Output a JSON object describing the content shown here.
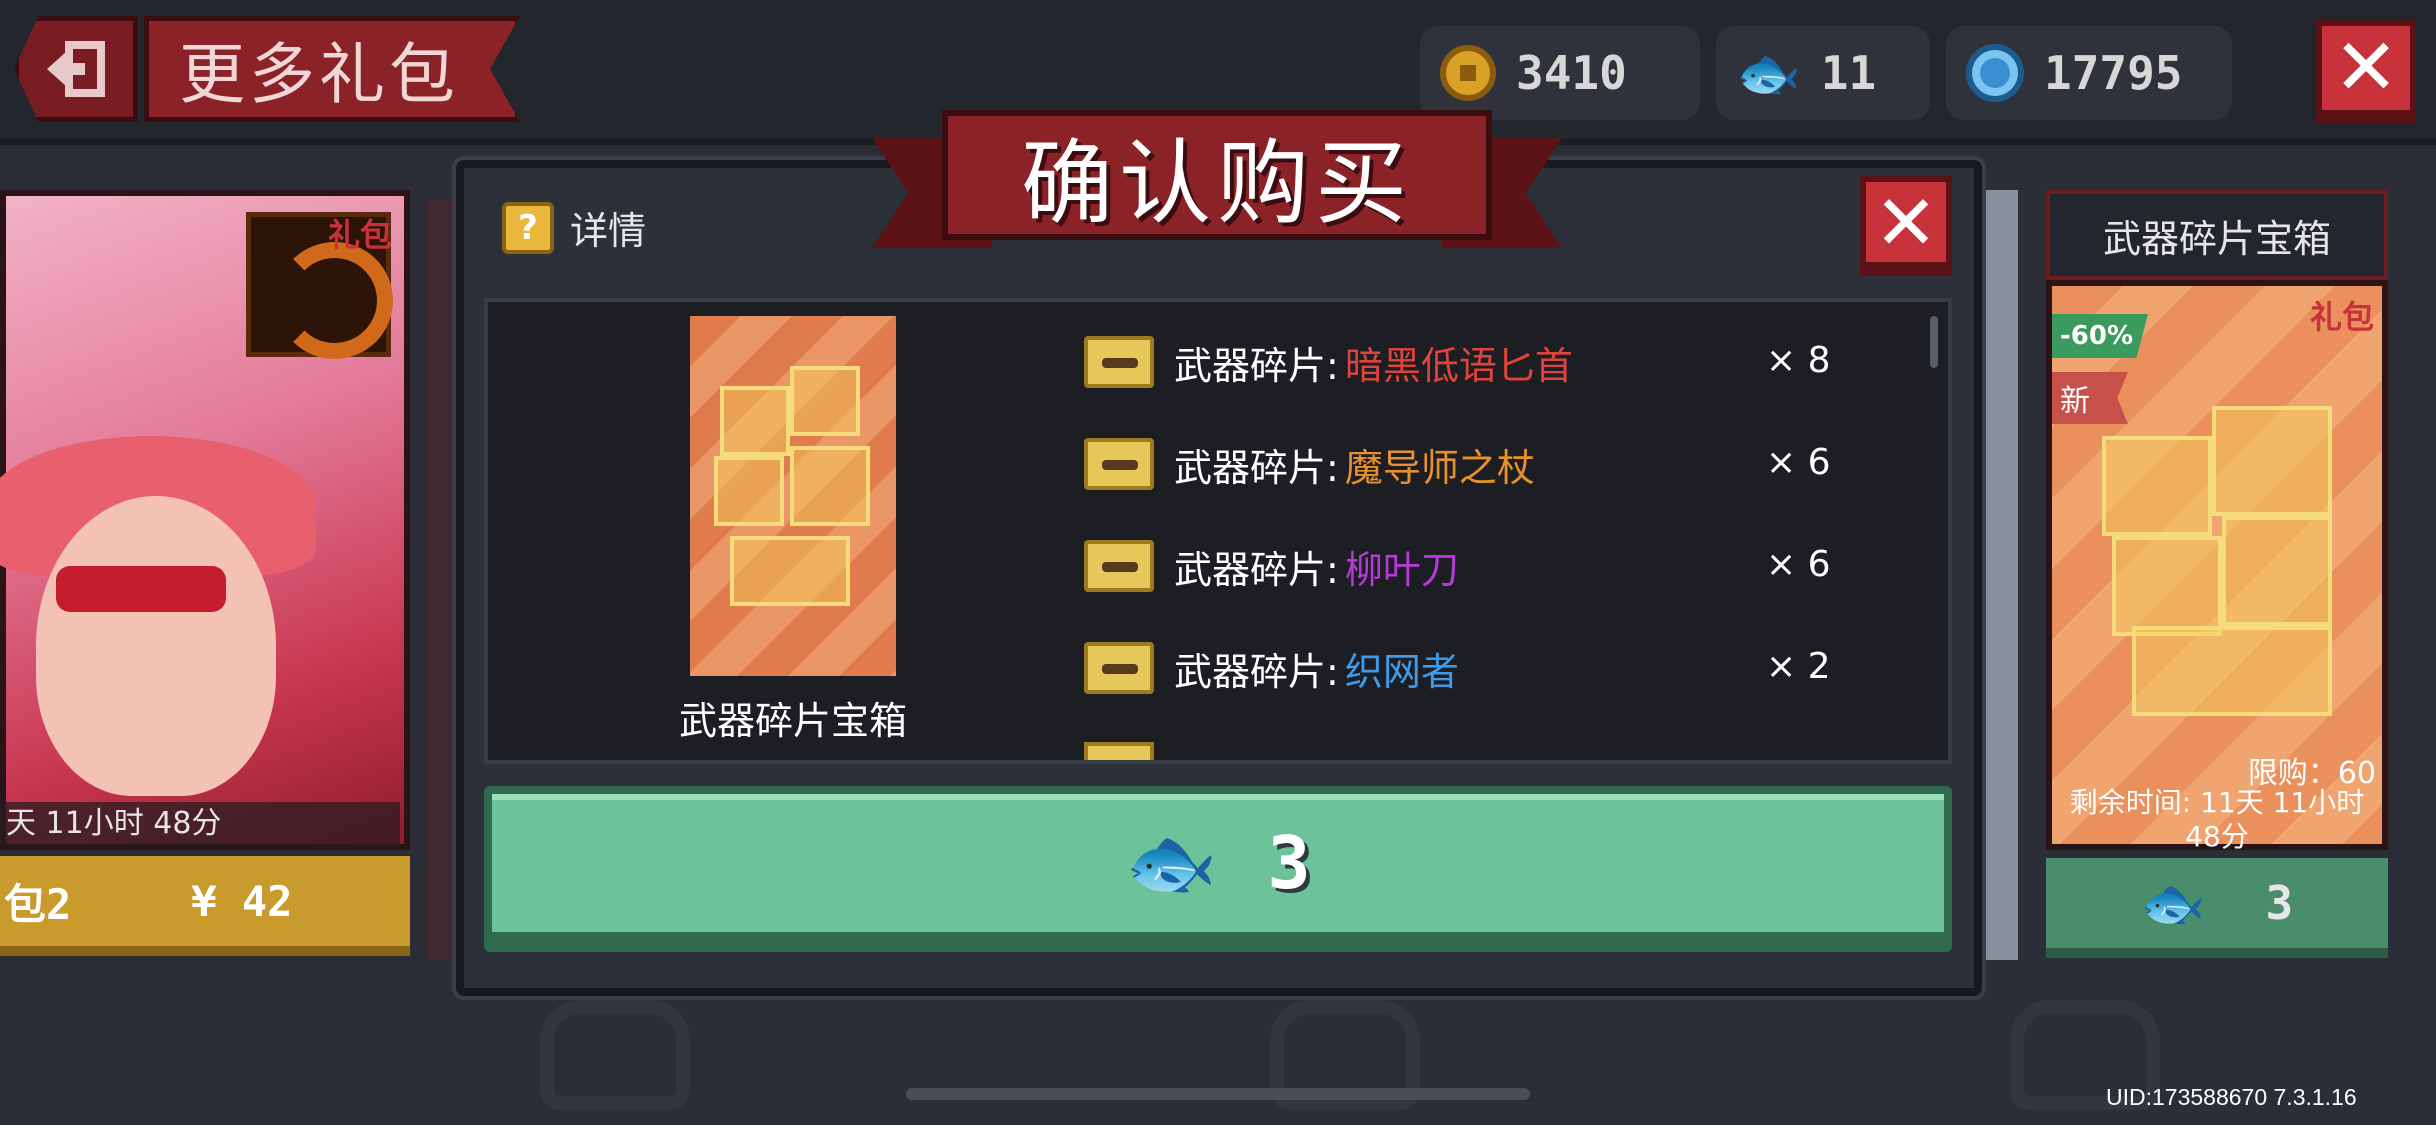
{
  "header": {
    "title": "更多礼包",
    "currencies": [
      {
        "icon": "gold-coin-icon",
        "amount": "3410"
      },
      {
        "icon": "fish-icon",
        "amount": "11"
      },
      {
        "icon": "gem-icon",
        "amount": "17795"
      }
    ]
  },
  "left_card": {
    "tag": "礼包",
    "timer": "天 11小时 48分",
    "name_partial": "包2",
    "price": "¥ 42"
  },
  "right_card": {
    "title": "武器碎片宝箱",
    "tag": "礼包",
    "discount": "-60%",
    "new_label": "新",
    "limit": "限购：60",
    "remaining": "剩余时间: 11天 11小时 48分",
    "price": "3"
  },
  "modal": {
    "title": "确认购买",
    "detail_label": "详情",
    "product_name": "武器碎片宝箱",
    "items": [
      {
        "prefix": "武器碎片:",
        "name": "暗黑低语匕首",
        "color": "#e0433b",
        "qty": "× 8"
      },
      {
        "prefix": "武器碎片:",
        "name": "魔导师之杖",
        "color": "#e8902c",
        "qty": "× 6"
      },
      {
        "prefix": "武器碎片:",
        "name": "柳叶刀",
        "color": "#b53ad8",
        "qty": "× 6"
      },
      {
        "prefix": "武器碎片:",
        "name": "织网者",
        "color": "#3f9ae8",
        "qty": "× 2"
      }
    ],
    "buy_price": "3"
  },
  "footer": {
    "uid": "UID:173588670 7.3.1.16"
  }
}
